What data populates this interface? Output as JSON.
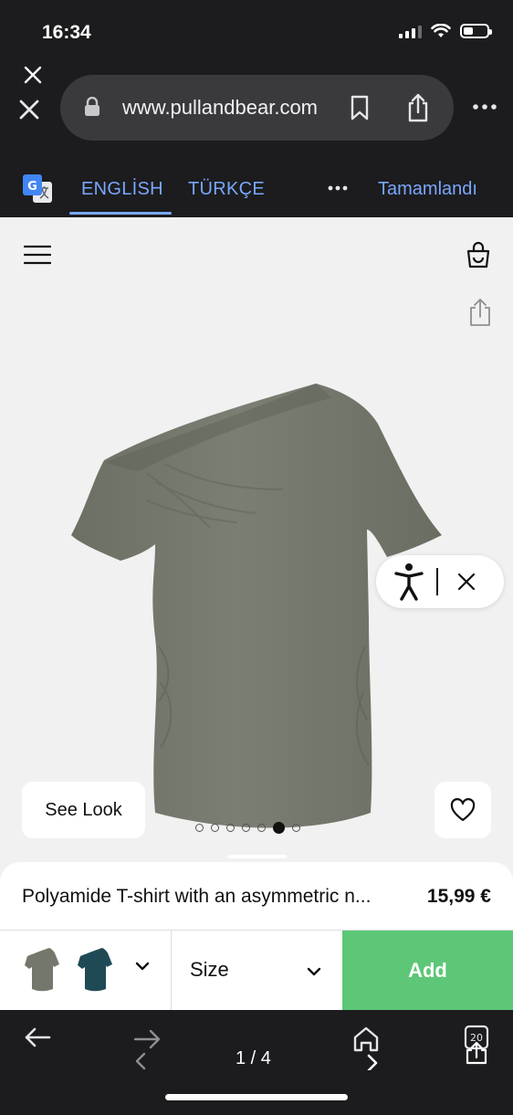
{
  "status_bar": {
    "time": "16:34",
    "battery_level": 0.4
  },
  "browser": {
    "url": "www.pullandbear.com"
  },
  "translate": {
    "tabs": [
      "ENGLİSH",
      "TÜRKÇE"
    ],
    "active_tab": "ENGLİSH",
    "done_label": "Tamamlandı"
  },
  "page": {
    "see_look_label": "See Look",
    "gallery": {
      "total_images": 7,
      "active_index": 5
    },
    "product": {
      "title": "Polyamide T-shirt with an asymmetric n...",
      "price": "15,99 €",
      "colors": [
        {
          "name": "khaki",
          "hex": "#74786c"
        },
        {
          "name": "teal",
          "hex": "#1f4a55"
        }
      ],
      "size_label": "Size",
      "add_label": "Add"
    }
  },
  "bottom_toolbar": {
    "page_counter": "1 / 4",
    "tabs_count": "20"
  },
  "colors": {
    "accent_blue": "#7aa7ff",
    "add_green": "#5dc777",
    "garment": "#75796d"
  }
}
